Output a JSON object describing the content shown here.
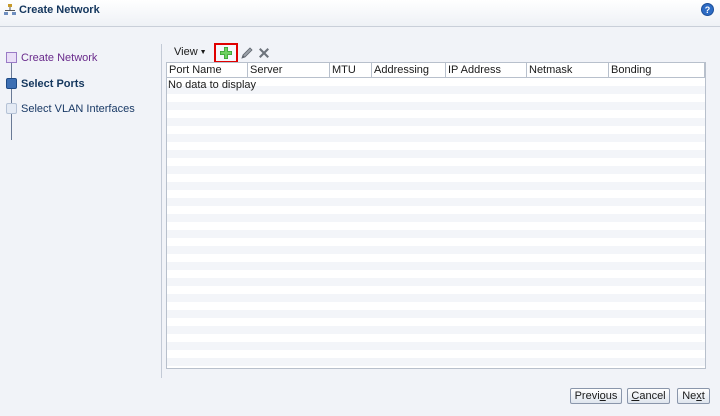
{
  "header": {
    "title": "Create Network",
    "help_glyph": "?"
  },
  "steps": [
    {
      "label": "Create Network",
      "state": "done"
    },
    {
      "label": "Select Ports",
      "state": "current"
    },
    {
      "label": "Select VLAN Interfaces",
      "state": "todo"
    }
  ],
  "toolbar": {
    "view_label": "View",
    "icons": [
      "add-icon",
      "edit-pencil-icon",
      "delete-x-icon"
    ]
  },
  "table": {
    "columns": [
      "Port Name",
      "Server",
      "MTU",
      "Addressing",
      "IP Address",
      "Netmask",
      "Bonding"
    ],
    "empty_text": "No data to display"
  },
  "footer": {
    "previous_first": "Previ",
    "previous_accel": "o",
    "previous_rest": "us",
    "cancel_accel": "C",
    "cancel_rest": "ancel",
    "next_first": "Ne",
    "next_accel": "x",
    "next_rest": "t"
  },
  "colors": {
    "accent": "#14365d",
    "highlight": "#e00000",
    "add_green": "#3aa335"
  }
}
